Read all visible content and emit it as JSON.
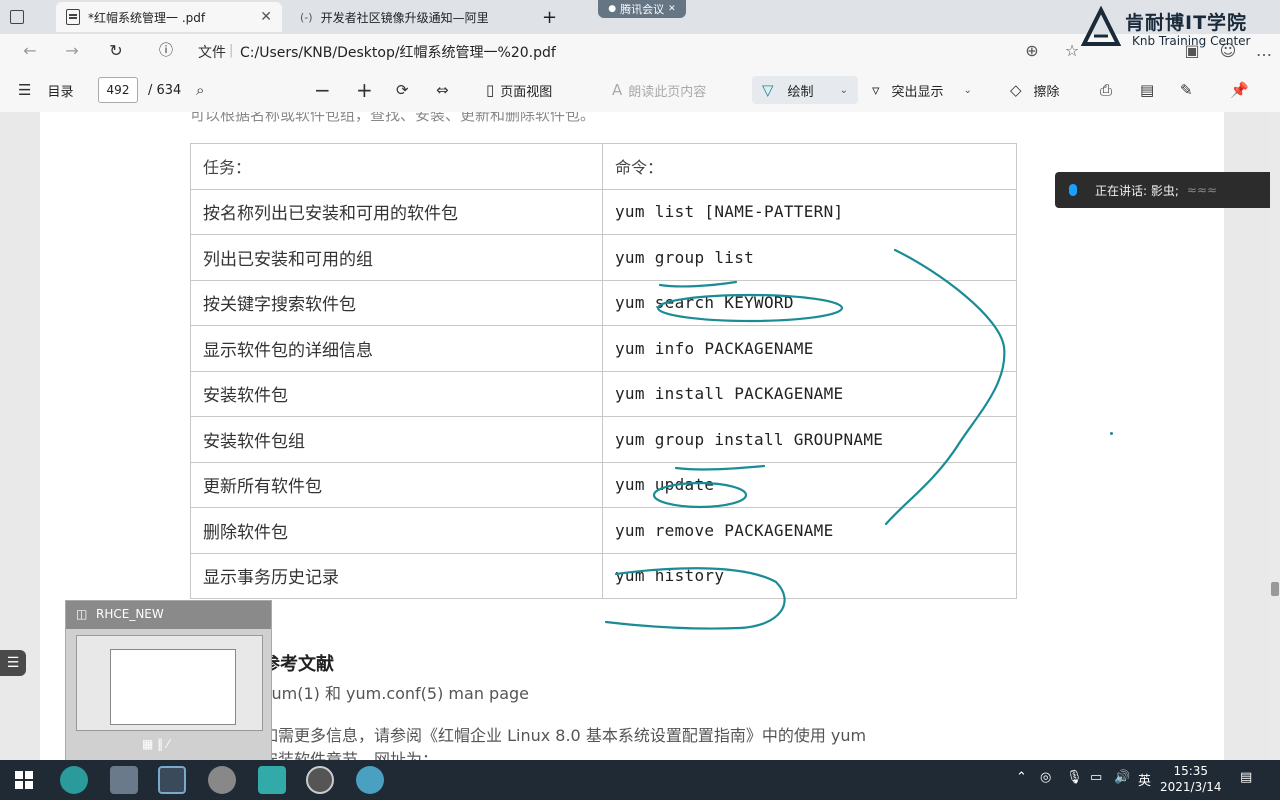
{
  "tabs": [
    {
      "title": "*红帽系统管理一 .pdf",
      "active": true
    },
    {
      "title": "开发者社区镜像升级通知—阿里",
      "active": false
    }
  ],
  "tencent_meeting": "腾讯会议",
  "address": {
    "label": "文件",
    "url": "C:/Users/KNB/Desktop/红帽系统管理一%20.pdf"
  },
  "logo": {
    "main": "肯耐博IT学院",
    "sub": "Knb Training Center"
  },
  "toolbar": {
    "toc": "目录",
    "page_current": "492",
    "page_total": "/ 634",
    "page_view": "页面视图",
    "read_aloud": "朗读此页内容",
    "draw": "绘制",
    "highlight": "突出显示",
    "erase": "擦除"
  },
  "speaking": "正在讲话: 影虫;",
  "doc": {
    "cut_text": "可以根据名称或软件包组，查找、安装、更新和删除软件包。",
    "headers": {
      "task": "任务：",
      "command": "命令："
    },
    "rows": [
      {
        "task": "按名称列出已安装和可用的软件包",
        "command": "yum list [NAME-PATTERN]"
      },
      {
        "task": "列出已安装和可用的组",
        "command": "yum group list"
      },
      {
        "task": "按关键字搜索软件包",
        "command": "yum search KEYWORD"
      },
      {
        "task": "显示软件包的详细信息",
        "command": "yum info PACKAGENAME"
      },
      {
        "task": "安装软件包",
        "command": "yum install PACKAGENAME"
      },
      {
        "task": "安装软件包组",
        "command": "yum group install GROUPNAME"
      },
      {
        "task": "更新所有软件包",
        "command": "yum update"
      },
      {
        "task": "删除软件包",
        "command": "yum remove PACKAGENAME"
      },
      {
        "task": "显示事务历史记录",
        "command": "yum history"
      }
    ],
    "ref_title": "参考文献",
    "ref_line1": "yum(1) 和 yum.conf(5) man page",
    "ref_line2": "如需更多信息，请参阅《红帽企业 Linux 8.0 基本系统设置配置指南》中的使用 yum",
    "ref_line3": "安装软件章节，网址为："
  },
  "thumbnail": {
    "title": "RHCE_NEW"
  },
  "taskbar": {
    "lang": "英",
    "time": "15:35",
    "date": "2021/3/14"
  }
}
